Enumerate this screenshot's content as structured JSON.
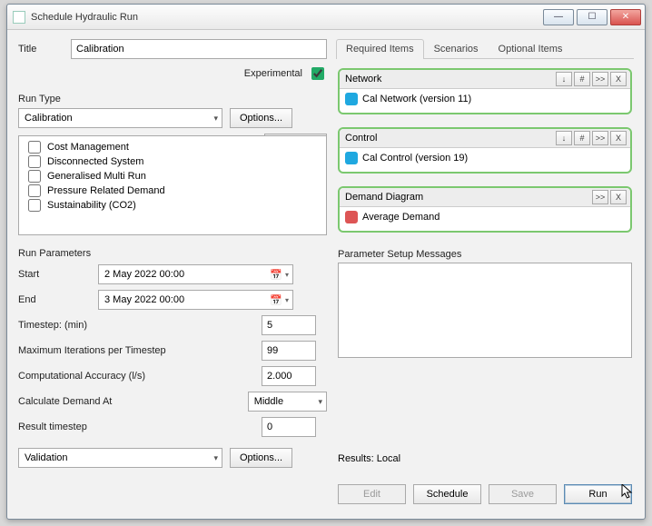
{
  "window_title": "Schedule Hydraulic Run",
  "title_label": "Title",
  "title_value": "Calibration",
  "experimental_label": "Experimental",
  "experimental_checked": true,
  "run_type_label": "Run Type",
  "run_type_value": "Calibration",
  "options_label": "Options...",
  "run_type_options": [
    "Cost Management",
    "Disconnected System",
    "Generalised Multi Run",
    "Pressure Related Demand",
    "Sustainability (CO2)"
  ],
  "run_params_label": "Run Parameters",
  "start_label": "Start",
  "start_value": "2     May     2022  00:00",
  "end_label": "End",
  "end_value": "3     May     2022  00:00",
  "timestep_label": "Timestep: (min)",
  "timestep_value": "5",
  "maxiter_label": "Maximum Iterations per Timestep",
  "maxiter_value": "99",
  "accuracy_label": "Computational Accuracy (l/s)",
  "accuracy_value": "2.000",
  "calc_demand_label": "Calculate Demand At",
  "calc_demand_value": "Middle",
  "result_ts_label": "Result timestep",
  "result_ts_value": "0",
  "validation_value": "Validation",
  "tabs": {
    "required": "Required Items",
    "scenarios": "Scenarios",
    "optional": "Optional Items"
  },
  "network": {
    "head": "Network",
    "item": "Cal Network (version 11)"
  },
  "control": {
    "head": "Control",
    "item": "Cal Control (version 19)"
  },
  "demand": {
    "head": "Demand Diagram",
    "item": "Average Demand"
  },
  "mini": {
    "down": "↓",
    "hash": "#",
    "dbl": ">>",
    "x": "X"
  },
  "psm_label": "Parameter Setup Messages",
  "results_label": "Results: Local",
  "actions": {
    "edit": "Edit",
    "schedule": "Schedule",
    "save": "Save",
    "run": "Run"
  }
}
